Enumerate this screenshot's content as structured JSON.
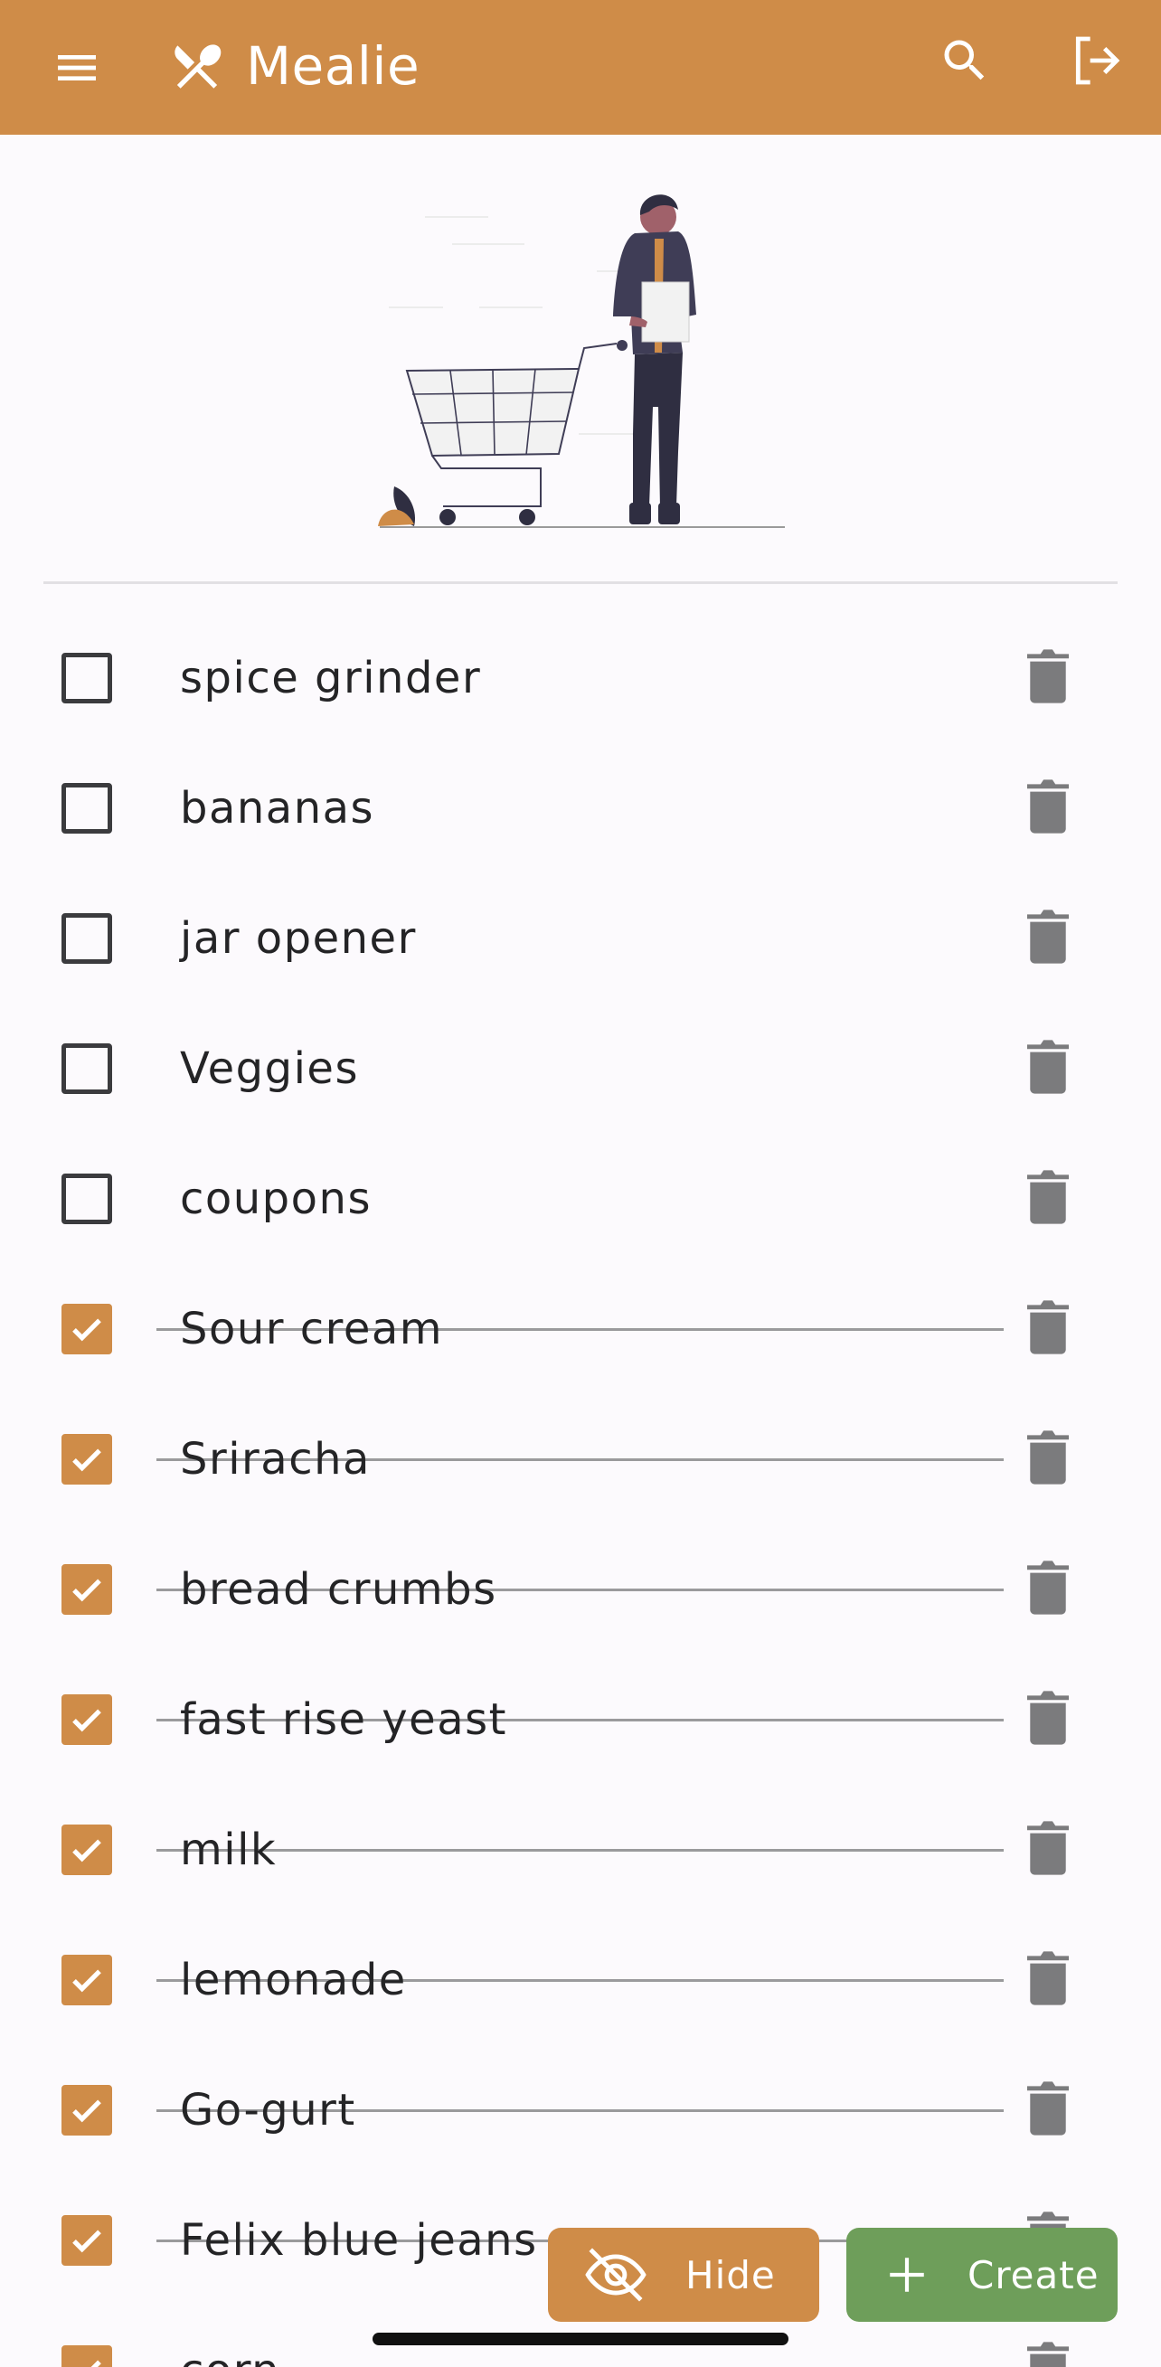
{
  "app": {
    "title": "Mealie",
    "accent_color": "#cf8c48",
    "success_color": "#6e9e5a"
  },
  "appbar": {
    "menu_icon": "menu-icon",
    "brand_icon": "silverware-icon",
    "search_icon": "search-icon",
    "logout_icon": "logout-icon"
  },
  "shopping_list": {
    "items": [
      {
        "label": "spice grinder",
        "checked": false
      },
      {
        "label": "bananas",
        "checked": false
      },
      {
        "label": "jar opener",
        "checked": false
      },
      {
        "label": "Veggies",
        "checked": false
      },
      {
        "label": "coupons",
        "checked": false
      },
      {
        "label": "Sour cream",
        "checked": true
      },
      {
        "label": "Sriracha",
        "checked": true
      },
      {
        "label": "bread crumbs",
        "checked": true
      },
      {
        "label": "fast rise yeast",
        "checked": true
      },
      {
        "label": "milk",
        "checked": true
      },
      {
        "label": "lemonade",
        "checked": true
      },
      {
        "label": "Go-gurt",
        "checked": true
      },
      {
        "label": "Felix blue jeans",
        "checked": true
      },
      {
        "label": "corn",
        "checked": true
      }
    ]
  },
  "actions": {
    "hide_label": "Hide",
    "hide_icon": "eye-off-icon",
    "create_label": "Create",
    "create_icon": "plus-icon"
  }
}
